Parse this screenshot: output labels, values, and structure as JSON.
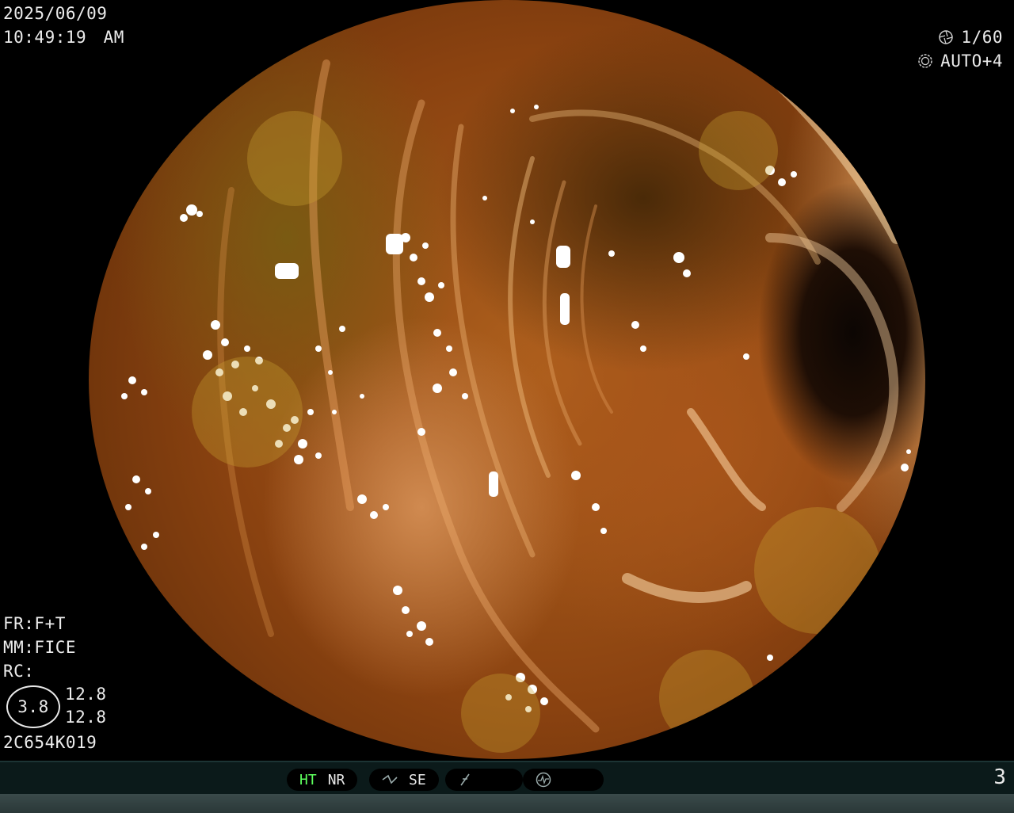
{
  "header_left": {
    "date": "2025/06/09",
    "time": "10:49:19　AM"
  },
  "header_right": {
    "shutter_icon": "aperture-icon",
    "shutter_value": "1/60",
    "iris_icon": "iris-ring-icon",
    "iris_value": "AUTO+4"
  },
  "info_left": {
    "fr": "FR:F+T",
    "mm": "MM:FICE",
    "rc": "RC:",
    "circle_value": "3.8",
    "value_top": "12.8",
    "value_bottom": "12.8",
    "serial": "2C654K019"
  },
  "status_bar": {
    "ht": "HT",
    "nr": "NR",
    "se": "SE",
    "curve_icon": "tone-curve-icon",
    "slash_icon": "enhance-slash-icon",
    "circle_icon": "pulse-circle-icon",
    "page_number": "3"
  },
  "colors": {
    "ht_active": "#5dff5d",
    "bar_bg": "#0b1a1a"
  }
}
